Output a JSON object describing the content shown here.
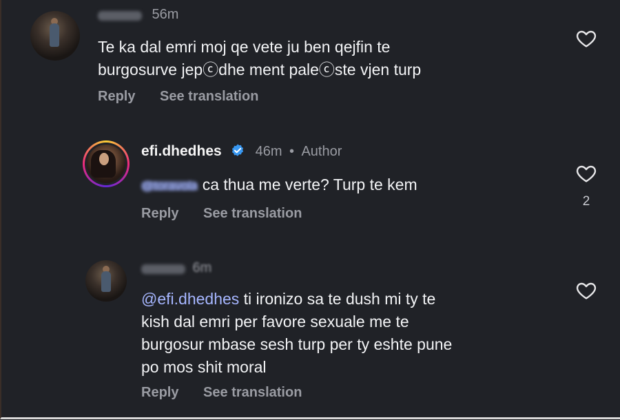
{
  "comments": [
    {
      "username": "toravola",
      "time": "56m",
      "text_line1": "Te ka dal emri moj qe vete ju ben qejfin te",
      "text_line2": "burgosurve jepⓒdhe ment paleⓒste vjen turp",
      "reply_label": "Reply",
      "translate_label": "See translation",
      "likes": ""
    },
    {
      "username": "efi.dhedhes",
      "time": "46m",
      "author_label": "Author",
      "mention": "@toravola",
      "text": "ca thua me verte? Turp te kem",
      "reply_label": "Reply",
      "translate_label": "See translation",
      "likes": "2"
    },
    {
      "username": "toravola",
      "time": "6m",
      "mention": "@efi.dhedhes",
      "text_line1": " ti ironizo sa te dush mi ty te",
      "text_line2": "kish dal emri per favore sexuale me te",
      "text_line3": "burgosur mbase sesh turp per ty eshte pune",
      "text_line4": "po mos shit moral",
      "reply_label": "Reply",
      "translate_label": "See translation",
      "likes": ""
    }
  ],
  "colors": {
    "background": "#202227",
    "mention": "#a6b6ff",
    "verified": "#3897f0",
    "muted": "#9a9ca3"
  },
  "icons": {
    "like": "heart-outline-icon",
    "verified": "verified-badge-icon"
  }
}
